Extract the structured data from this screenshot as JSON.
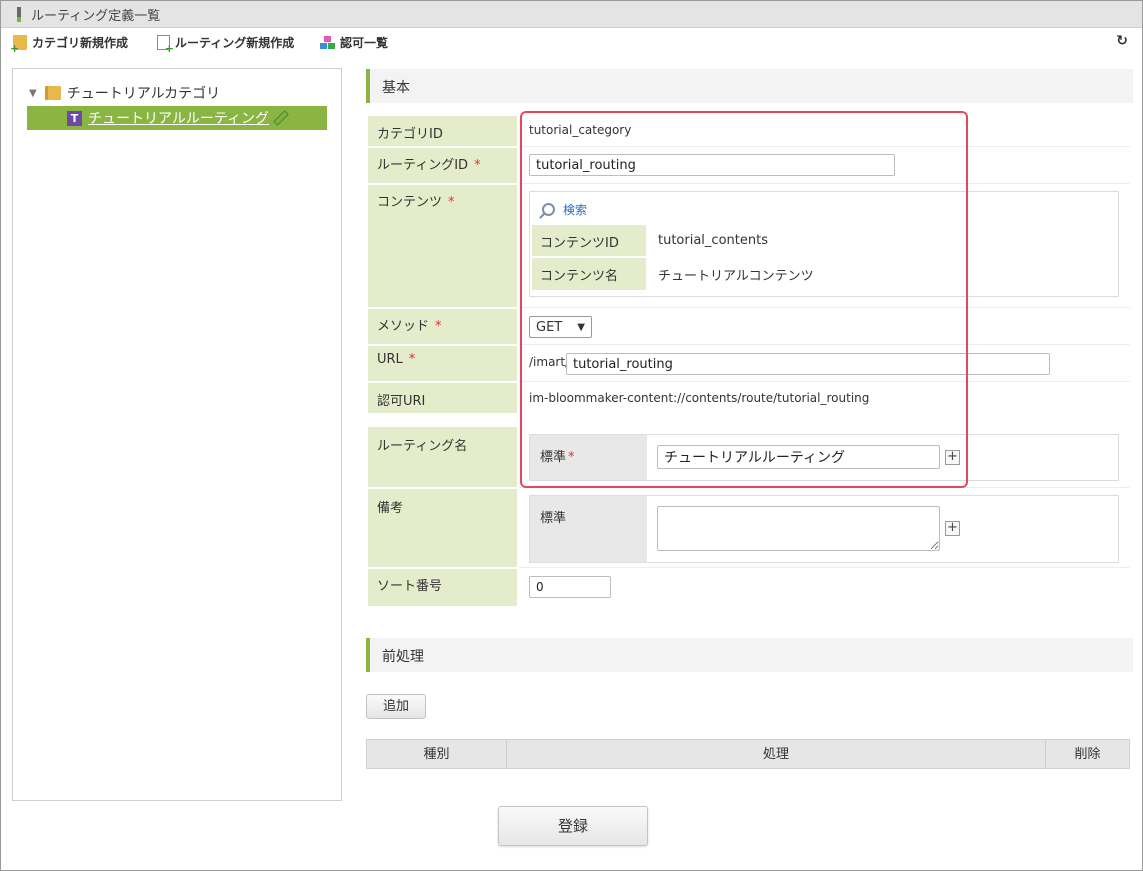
{
  "window": {
    "title": "ルーティング定義一覧"
  },
  "toolbar": {
    "new_category": "カテゴリ新規作成",
    "new_routing": "ルーティング新規作成",
    "permission_list": "認可一覧",
    "refresh_icon": "refresh-icon"
  },
  "tree": {
    "root_label": "チュートリアルカテゴリ",
    "selected_label": "チュートリアルルーティング",
    "selected_icon_letter": "T"
  },
  "sections": {
    "basic": "基本",
    "preprocess": "前処理"
  },
  "form": {
    "category_id": {
      "label": "カテゴリID",
      "value": "tutorial_category"
    },
    "routing_id": {
      "label": "ルーティングID",
      "required_mark": "*",
      "value": "tutorial_routing"
    },
    "contents": {
      "label": "コンテンツ",
      "required_mark": "*",
      "search_label": "検索",
      "contents_id_label": "コンテンツID",
      "contents_id_value": "tutorial_contents",
      "contents_name_label": "コンテンツ名",
      "contents_name_value": "チュートリアルコンテンツ"
    },
    "method": {
      "label": "メソッド",
      "required_mark": "*",
      "value": "GET"
    },
    "url": {
      "label": "URL",
      "required_mark": "*",
      "prefix": "/imart/",
      "value": "tutorial_routing"
    },
    "auth_uri": {
      "label": "認可URI",
      "value": "im-bloommaker-content://contents/route/tutorial_routing"
    },
    "routing_name": {
      "label": "ルーティング名",
      "locale_label": "標準",
      "required_mark": "*",
      "value": "チュートリアルルーティング"
    },
    "remarks": {
      "label": "備考",
      "locale_label": "標準",
      "value": ""
    },
    "sort_number": {
      "label": "ソート番号",
      "value": "0"
    }
  },
  "preprocess": {
    "add_button": "追加",
    "columns": [
      "種別",
      "処理",
      "削除"
    ]
  },
  "register_button": "登録",
  "colors": {
    "accent": "#8bb543",
    "label_bg": "#e4eccb",
    "highlight": "#e24a5a"
  }
}
